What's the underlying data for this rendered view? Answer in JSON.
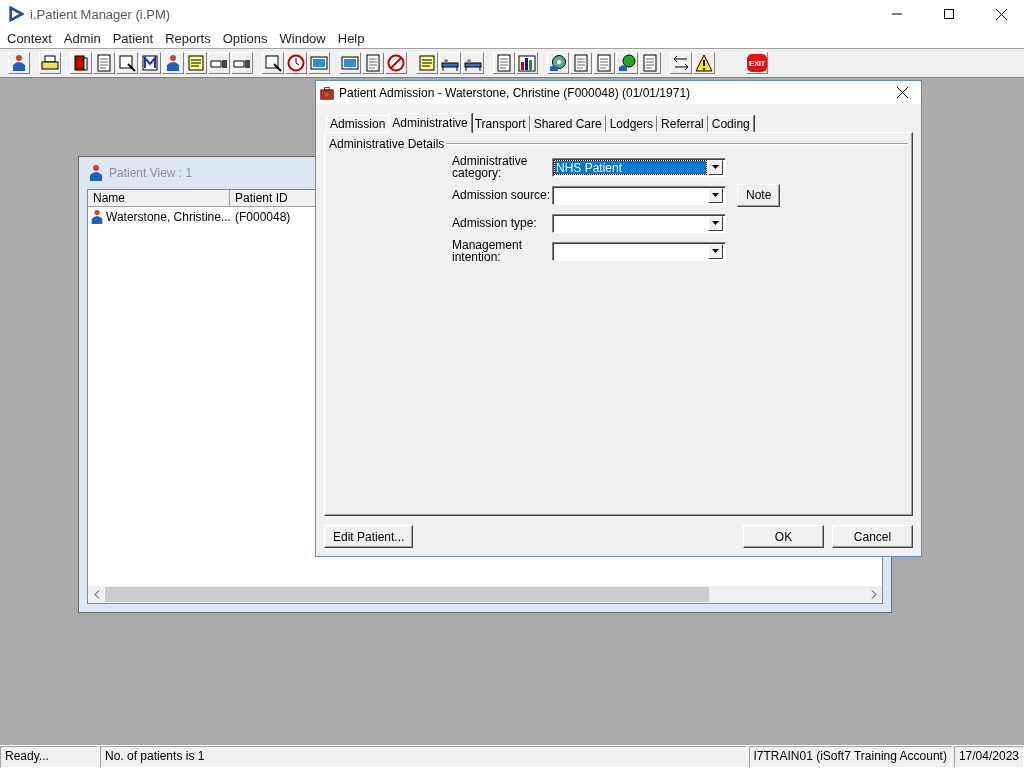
{
  "app": {
    "title": "i.Patient Manager (i.PM)"
  },
  "menu": [
    "Context",
    "Admin",
    "Patient",
    "Reports",
    "Options",
    "Window",
    "Help"
  ],
  "toolbar": {
    "exit_label": "EXIT"
  },
  "patient_view": {
    "title": "Patient View : 1",
    "active": false,
    "columns": [
      "Name",
      "Patient ID"
    ],
    "rows": [
      {
        "name": "Waterstone, Christine...",
        "patient_id": "(F000048)"
      }
    ]
  },
  "dialog": {
    "title": "Patient Admission - Waterstone, Christine (F000048) (01/01/1971)",
    "tabs": [
      {
        "label": "Admission",
        "selected": false
      },
      {
        "label": "Administrative",
        "selected": true
      },
      {
        "label": "Transport",
        "selected": false
      },
      {
        "label": "Shared Care",
        "selected": false
      },
      {
        "label": "Lodgers",
        "selected": false
      },
      {
        "label": "Referral",
        "selected": false
      },
      {
        "label": "Coding",
        "selected": false
      }
    ],
    "group_label": "Administrative Details",
    "fields": [
      {
        "label": "Administrative category:",
        "value": "NHS Patient",
        "focused": true
      },
      {
        "label": "Admission source:",
        "focused": false,
        "note": "Note"
      },
      {
        "label": "Admission type:",
        "focused": false
      },
      {
        "label": "Management intention:",
        "focused": false
      }
    ],
    "edit_button": "Edit Patient...",
    "ok_button": "OK",
    "cancel_button": "Cancel"
  },
  "status_bar": [
    "Ready...",
    "No. of patients is 1",
    "I7TRAIN01 (iSoft7 Training Account)",
    "17/04/2023"
  ]
}
